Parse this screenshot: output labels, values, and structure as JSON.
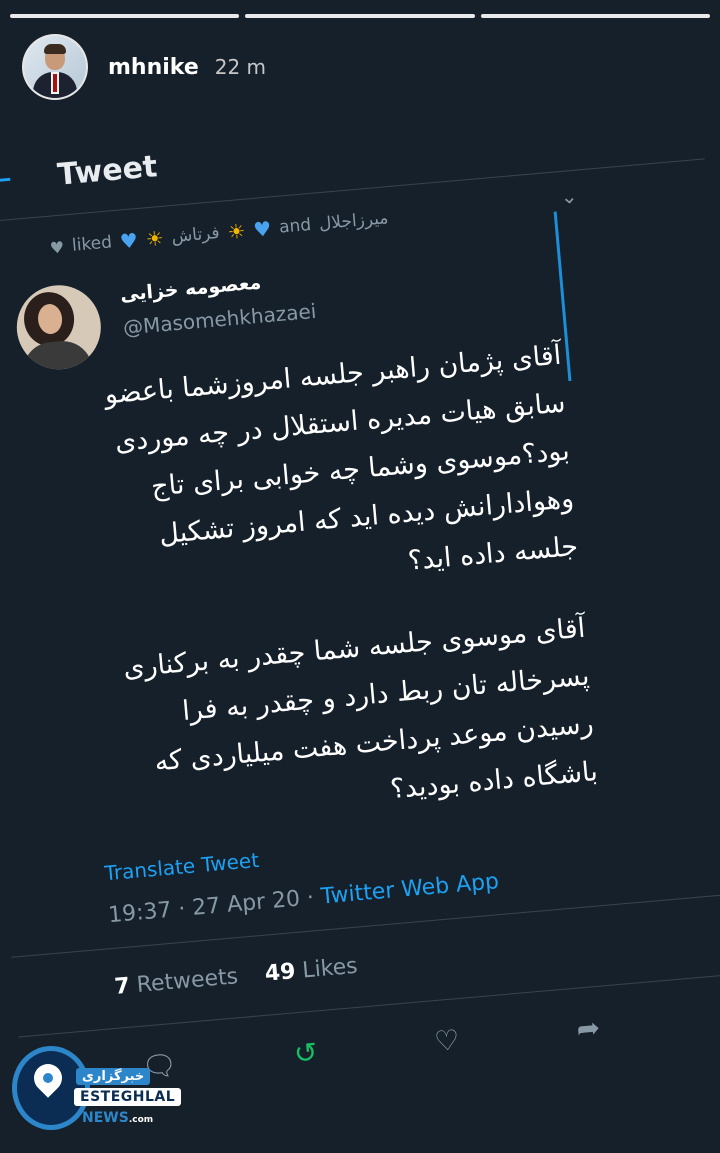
{
  "story": {
    "username": "mhnike",
    "time_ago": "22 m"
  },
  "tweet": {
    "header_title": "Tweet",
    "liked_by": {
      "liked_label": "liked",
      "first_name": "فرتاش",
      "and_label": "and",
      "second_name": "میرزاجلال"
    },
    "author": {
      "display_name": "معصومه خزایی",
      "handle": "@Masomehkhazaei"
    },
    "body_paragraph_1": [
      "آقای پژمان راهبر جلسه امروزشما باعضو",
      "سابق هیات مدیره استقلال در چه موردی",
      "بود؟موسوی وشما چه خوابی برای تاج",
      "وهوادارانش دیده اید که امروز تشکیل",
      "جلسه داده اید؟"
    ],
    "body_paragraph_2": [
      "آقای موسوی جلسه شما چقدر به برکناری",
      "پسرخاله تان ربط دارد و چقدر به فرا",
      "رسیدن موعد پرداخت هفت میلیاردی که",
      "باشگاه داده بودید؟"
    ],
    "translate_label": "Translate Tweet",
    "timestamp": "19:37 · 27 Apr 20 · ",
    "source_app": "Twitter Web App",
    "retweets_count": "7",
    "retweets_label": "Retweets",
    "likes_count": "49",
    "likes_label": "Likes"
  },
  "icons": {
    "back": "arrow-left-icon",
    "chevron": "chevron-down-icon",
    "reply": "reply-icon",
    "retweet": "retweet-icon",
    "like": "heart-icon",
    "share": "share-icon"
  },
  "watermark": {
    "persian_label": "خبرگزاری",
    "brand": "ESTEGHLAL",
    "news": "NEWS",
    "domain_suffix": ".com"
  },
  "colors": {
    "background": "#15202b",
    "accent": "#1da1f2",
    "retweet": "#17bf63",
    "muted": "#8899a6"
  }
}
